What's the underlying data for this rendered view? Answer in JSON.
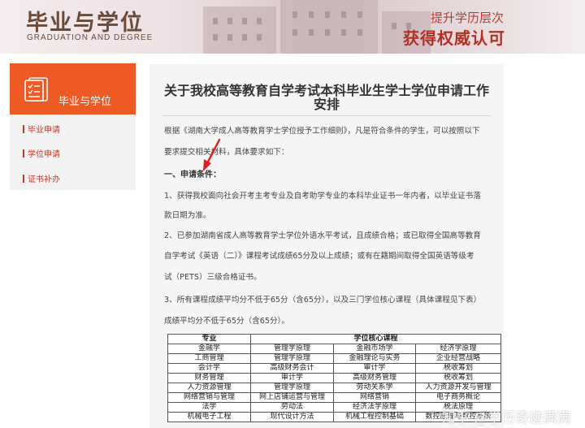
{
  "banner": {
    "title": "毕业与学位",
    "subtitle": "GRADUATION AND DEGREE",
    "slogan_top": "提升学历层次",
    "slogan_main": "获得权威认可"
  },
  "sidebar": {
    "title": "毕业与学位",
    "items": [
      {
        "label": "毕业申请"
      },
      {
        "label": "学位申请"
      },
      {
        "label": "证书补办"
      }
    ]
  },
  "article": {
    "title": "关于我校高等教育自学考试本科毕业生学士学位申请工作安排",
    "intro_1": "根据《湖南大学成人高等教育学士学位授予工作细则》，凡是符合条件的学生，可以按照以下",
    "intro_2": "要求提交相关材料，具体要求如下：",
    "section_1": "一、申请条件：",
    "c1_l1": "1、获得我校面向社会开考主考专业及自考助学专业的本科毕业证书一年内者，以毕业证书落",
    "c1_l2": "款日期为准。",
    "c2_l1": "2、已参加湖南省成人高等教育学士学位外语水平考试，且成绩合格；或已取得全国高等教育",
    "c2_l2": "自学考试《英语（二）》课程考试成绩65分及以上成绩；或有在籍期间取得全国英语等级考",
    "c2_l3": "试（PETS）三级合格证书。",
    "c3_l1": "3、所有课程成绩平均分不低于65分（含65分），以及三门学位核心课程（具体课程见下表）",
    "c3_l2": "成绩平均分不低于65分（含65分）。"
  },
  "table": {
    "header_major": "专业",
    "header_core": "学位核心课程",
    "rows": [
      [
        "金融学",
        "管理学原理",
        "金融市场学",
        "经济学原理"
      ],
      [
        "工商管理",
        "管理学原理",
        "金融理论与实务",
        "企业经营战略"
      ],
      [
        "会计学",
        "高级财务会计",
        "审计学",
        "税收筹划"
      ],
      [
        "财务管理",
        "审计学",
        "高级财务管理",
        "税收筹划"
      ],
      [
        "人力资源管理",
        "管理学原理",
        "劳动关系学",
        "人力资源开发与管理"
      ],
      [
        "网络营销与管理",
        "网上店铺运营与管理",
        "网络营销",
        "电子商务概论"
      ],
      [
        "法学",
        "劳动法",
        "经济法学原理",
        "税法原理"
      ],
      [
        "机械电子工程",
        "现代设计方法",
        "机械工程控制基础",
        "数控原理与数控系统"
      ]
    ]
  },
  "watermark": "知乎 @学历奇迹满满",
  "colors": {
    "accent": "#ee5a24",
    "link_red": "#c0392b",
    "banner_text": "#6b4a3a"
  }
}
